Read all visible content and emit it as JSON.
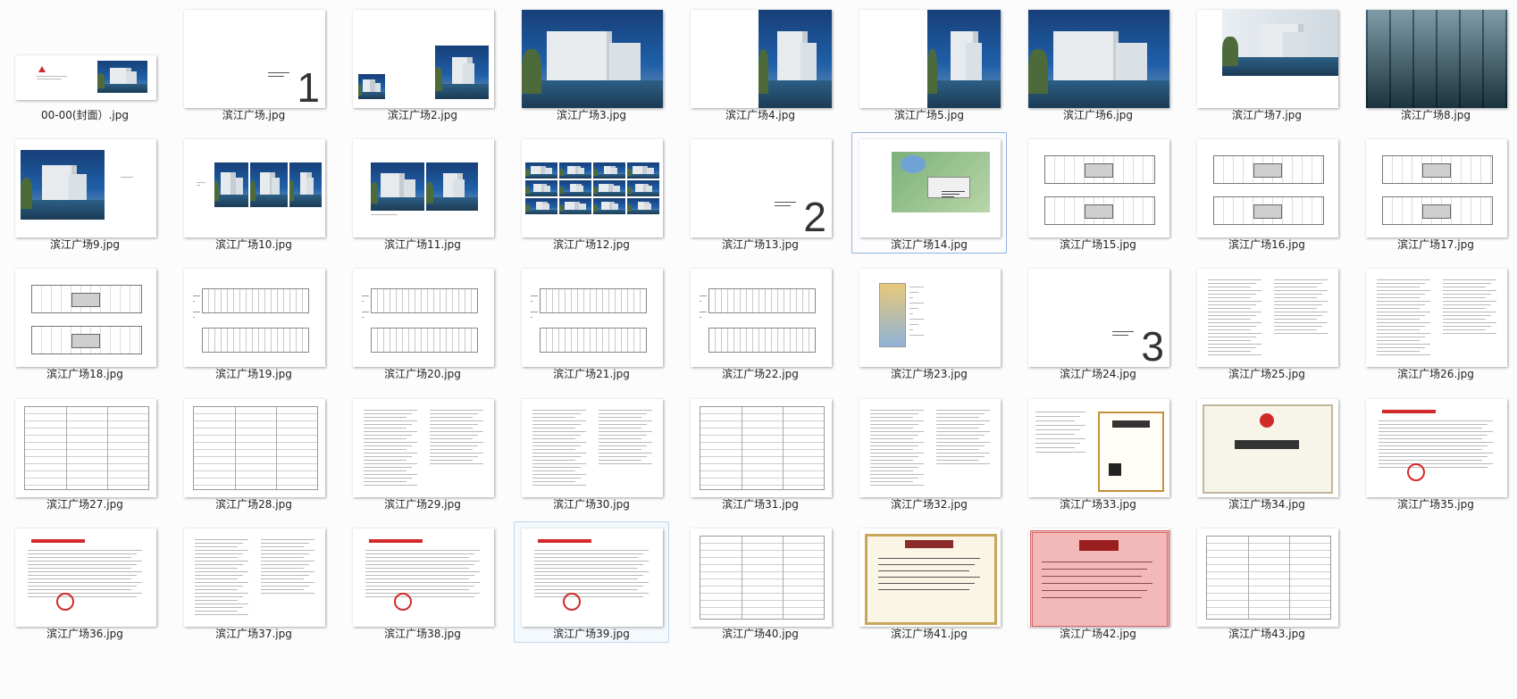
{
  "files": [
    {
      "name": "00-00(封面）.jpg",
      "kind": "cover"
    },
    {
      "name": "滨江广场.jpg",
      "kind": "section",
      "num": "1"
    },
    {
      "name": "滨江广场2.jpg",
      "kind": "photo-pair"
    },
    {
      "name": "滨江广场3.jpg",
      "kind": "photo-full"
    },
    {
      "name": "滨江广场4.jpg",
      "kind": "photo-right"
    },
    {
      "name": "滨江广场5.jpg",
      "kind": "photo-right"
    },
    {
      "name": "滨江广场6.jpg",
      "kind": "photo-full"
    },
    {
      "name": "滨江广场7.jpg",
      "kind": "photo-top"
    },
    {
      "name": "滨江广场8.jpg",
      "kind": "photo-glass"
    },
    {
      "name": "滨江广场9.jpg",
      "kind": "photo-left"
    },
    {
      "name": "滨江广场10.jpg",
      "kind": "photo-triple"
    },
    {
      "name": "滨江广场11.jpg",
      "kind": "photo-wide"
    },
    {
      "name": "滨江广场12.jpg",
      "kind": "photo-collage"
    },
    {
      "name": "滨江广场13.jpg",
      "kind": "section",
      "num": "2"
    },
    {
      "name": "滨江广场14.jpg",
      "kind": "siteplan"
    },
    {
      "name": "滨江广场15.jpg",
      "kind": "plan"
    },
    {
      "name": "滨江广场16.jpg",
      "kind": "plan"
    },
    {
      "name": "滨江广场17.jpg",
      "kind": "plan"
    },
    {
      "name": "滨江广场18.jpg",
      "kind": "plan"
    },
    {
      "name": "滨江广场19.jpg",
      "kind": "elevation"
    },
    {
      "name": "滨江广场20.jpg",
      "kind": "elevation"
    },
    {
      "name": "滨江广场21.jpg",
      "kind": "elevation"
    },
    {
      "name": "滨江广场22.jpg",
      "kind": "elevation"
    },
    {
      "name": "滨江广场23.jpg",
      "kind": "detail"
    },
    {
      "name": "滨江广场24.jpg",
      "kind": "section",
      "num": "3"
    },
    {
      "name": "滨江广场25.jpg",
      "kind": "document"
    },
    {
      "name": "滨江广场26.jpg",
      "kind": "document"
    },
    {
      "name": "滨江广场27.jpg",
      "kind": "table"
    },
    {
      "name": "滨江广场28.jpg",
      "kind": "table"
    },
    {
      "name": "滨江广场29.jpg",
      "kind": "document"
    },
    {
      "name": "滨江广场30.jpg",
      "kind": "document"
    },
    {
      "name": "滨江广场31.jpg",
      "kind": "table"
    },
    {
      "name": "滨江广场32.jpg",
      "kind": "document"
    },
    {
      "name": "滨江广场33.jpg",
      "kind": "license"
    },
    {
      "name": "滨江广场34.jpg",
      "kind": "certificate"
    },
    {
      "name": "滨江广场35.jpg",
      "kind": "letter"
    },
    {
      "name": "滨江广场36.jpg",
      "kind": "letter"
    },
    {
      "name": "滨江广场37.jpg",
      "kind": "document"
    },
    {
      "name": "滨江广场38.jpg",
      "kind": "letter"
    },
    {
      "name": "滨江广场39.jpg",
      "kind": "letter"
    },
    {
      "name": "滨江广场40.jpg",
      "kind": "table"
    },
    {
      "name": "滨江广场41.jpg",
      "kind": "honor"
    },
    {
      "name": "滨江广场42.jpg",
      "kind": "award"
    },
    {
      "name": "滨江广场43.jpg",
      "kind": "table"
    }
  ],
  "selected_index": 14,
  "hover_index": 39,
  "colors": {
    "sky": "#1f5fa8",
    "sky_dark": "#173f78",
    "building": "#e7ebee",
    "water": "#2c5f86",
    "tree": "#4d6b3a",
    "seal": "#d22a2a",
    "honor_border": "#c9a75a",
    "award_bg": "#f3b9b9"
  }
}
